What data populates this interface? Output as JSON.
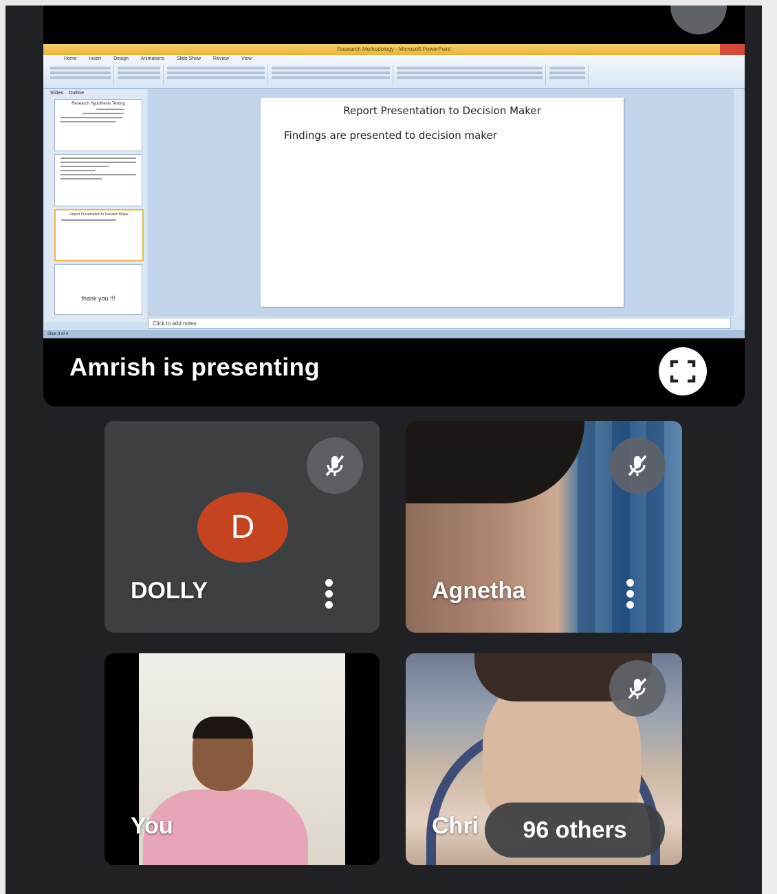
{
  "presentation": {
    "presenter_label": "Amrish is presenting",
    "app": {
      "window_title": "Research Methodology - Microsoft PowerPoint",
      "ribbon_tabs": [
        "Home",
        "Insert",
        "Design",
        "Animations",
        "Slide Show",
        "Review",
        "View"
      ],
      "panel_tabs": [
        "Slides",
        "Outline"
      ],
      "notes_placeholder": "Click to add notes",
      "status_text": "Slide 3 of 4",
      "thumbnails": [
        {
          "label": "Research Hypothesis Testing"
        },
        {
          "label": ""
        },
        {
          "label": "Report Presentation to Decision Maker"
        },
        {
          "label": "thank you !!!"
        }
      ]
    },
    "slide": {
      "title": "Report Presentation to Decision Maker",
      "body": "Findings are presented to decision maker"
    }
  },
  "participants": [
    {
      "name": "DOLLY",
      "initial": "D",
      "avatar_color": "#c5441f",
      "muted": true
    },
    {
      "name": "Agnetha",
      "muted": true
    },
    {
      "name": "You",
      "muted": false
    },
    {
      "name": "Chri",
      "muted": true
    }
  ],
  "others": {
    "label": "96 others"
  },
  "colors": {
    "background": "#202124",
    "tile": "#3c4043",
    "mic_button": "#5f6368"
  }
}
